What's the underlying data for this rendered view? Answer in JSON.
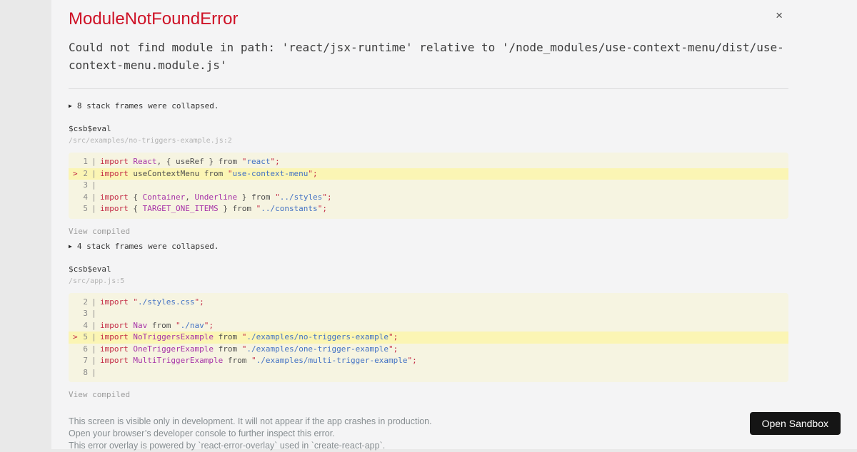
{
  "icons": {
    "close": "×",
    "collapse_arrow": "▶",
    "highlight_marker": ">"
  },
  "colors": {
    "page_background": "#e9e9e9",
    "overlay_background": "#f4f4f5",
    "error_red": "#ce1126",
    "code_keyword": "#c32b45",
    "code_identifier": "#a632a8",
    "code_string": "#4372c4",
    "code_block_background": "rgba(251,245,180,0.3)",
    "code_highlight_background": "#fbf5b4",
    "sandbox_button_background": "#151515"
  },
  "error": {
    "name": "ModuleNotFoundError",
    "message": "Could not find module in path: 'react/jsx-runtime' relative to '/node_modules/use-context-menu/dist/use-context-menu.module.js'"
  },
  "frames": [
    {
      "collapsed_label": "8 stack frames were collapsed.",
      "function_name": "$csb$eval",
      "file_location": "/src/examples/no-triggers-example.js:2",
      "view_compiled_label": "View compiled",
      "code": {
        "highlight_line": 2,
        "lines": [
          {
            "num": 1,
            "tokens": [
              [
                "k",
                "import"
              ],
              [
                "p",
                " "
              ],
              [
                "i",
                "React"
              ],
              [
                "p",
                ", { useRef } from "
              ],
              [
                "q",
                "\""
              ],
              [
                "s",
                "react"
              ],
              [
                "q",
                "\""
              ],
              [
                "k",
                ";"
              ]
            ]
          },
          {
            "num": 2,
            "tokens": [
              [
                "k",
                "import"
              ],
              [
                "p",
                " useContextMenu from "
              ],
              [
                "q",
                "\""
              ],
              [
                "s",
                "use-context-menu"
              ],
              [
                "q",
                "\""
              ],
              [
                "k",
                ";"
              ]
            ]
          },
          {
            "num": 3,
            "tokens": []
          },
          {
            "num": 4,
            "tokens": [
              [
                "k",
                "import"
              ],
              [
                "p",
                " { "
              ],
              [
                "i",
                "Container"
              ],
              [
                "p",
                ", "
              ],
              [
                "i",
                "Underline"
              ],
              [
                "p",
                " } from "
              ],
              [
                "q",
                "\""
              ],
              [
                "s",
                "../styles"
              ],
              [
                "q",
                "\""
              ],
              [
                "k",
                ";"
              ]
            ]
          },
          {
            "num": 5,
            "tokens": [
              [
                "k",
                "import"
              ],
              [
                "p",
                " { "
              ],
              [
                "i",
                "TARGET_ONE_ITEMS"
              ],
              [
                "p",
                " } from "
              ],
              [
                "q",
                "\""
              ],
              [
                "s",
                "../constants"
              ],
              [
                "q",
                "\""
              ],
              [
                "k",
                ";"
              ]
            ]
          }
        ]
      }
    },
    {
      "collapsed_label": "4 stack frames were collapsed.",
      "function_name": "$csb$eval",
      "file_location": "/src/app.js:5",
      "view_compiled_label": "View compiled",
      "code": {
        "highlight_line": 5,
        "lines": [
          {
            "num": 2,
            "tokens": [
              [
                "k",
                "import"
              ],
              [
                "p",
                " "
              ],
              [
                "q",
                "\""
              ],
              [
                "s",
                "./styles.css"
              ],
              [
                "q",
                "\""
              ],
              [
                "k",
                ";"
              ]
            ]
          },
          {
            "num": 3,
            "tokens": []
          },
          {
            "num": 4,
            "tokens": [
              [
                "k",
                "import"
              ],
              [
                "p",
                " "
              ],
              [
                "i",
                "Nav"
              ],
              [
                "p",
                " from "
              ],
              [
                "q",
                "\""
              ],
              [
                "s",
                "./nav"
              ],
              [
                "q",
                "\""
              ],
              [
                "k",
                ";"
              ]
            ]
          },
          {
            "num": 5,
            "tokens": [
              [
                "k",
                "import"
              ],
              [
                "p",
                " "
              ],
              [
                "i",
                "NoTriggersExample"
              ],
              [
                "p",
                " from "
              ],
              [
                "q",
                "\""
              ],
              [
                "s",
                "./examples/no-triggers-example"
              ],
              [
                "q",
                "\""
              ],
              [
                "k",
                ";"
              ]
            ]
          },
          {
            "num": 6,
            "tokens": [
              [
                "k",
                "import"
              ],
              [
                "p",
                " "
              ],
              [
                "i",
                "OneTriggerExample"
              ],
              [
                "p",
                " from "
              ],
              [
                "q",
                "\""
              ],
              [
                "s",
                "./examples/one-trigger-example"
              ],
              [
                "q",
                "\""
              ],
              [
                "k",
                ";"
              ]
            ]
          },
          {
            "num": 7,
            "tokens": [
              [
                "k",
                "import"
              ],
              [
                "p",
                " "
              ],
              [
                "i",
                "MultiTriggerExample"
              ],
              [
                "p",
                " from "
              ],
              [
                "q",
                "\""
              ],
              [
                "s",
                "./examples/multi-trigger-example"
              ],
              [
                "q",
                "\""
              ],
              [
                "k",
                ";"
              ]
            ]
          },
          {
            "num": 8,
            "tokens": []
          }
        ]
      }
    }
  ],
  "footer": {
    "lines": [
      "This screen is visible only in development. It will not appear if the app crashes in production.",
      "Open your browser’s developer console to further inspect this error.",
      "This error overlay is powered by `react-error-overlay` used in `create-react-app`."
    ]
  },
  "sandbox_button": {
    "label": "Open Sandbox"
  }
}
